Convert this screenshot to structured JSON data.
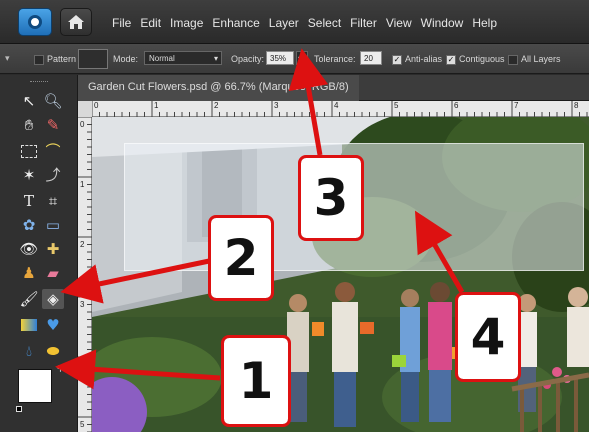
{
  "menu": {
    "items": [
      "File",
      "Edit",
      "Image",
      "Enhance",
      "Layer",
      "Select",
      "Filter",
      "View",
      "Window",
      "Help"
    ]
  },
  "options": {
    "pattern_label": "Pattern",
    "mode_label": "Mode:",
    "mode_value": "Normal",
    "opacity_label": "Opacity:",
    "opacity_value": "35%",
    "tolerance_label": "Tolerance:",
    "tolerance_value": "20",
    "antialias_label": "Anti-alias",
    "antialias_checked": true,
    "contiguous_label": "Contiguous",
    "contiguous_checked": true,
    "all_layers_label": "All Layers",
    "all_layers_checked": false
  },
  "document": {
    "tab_title": "Garden Cut Flowers.psd @ 66.7% (Marquee, RGB/8)"
  },
  "rulers": {
    "top": [
      "0",
      "1",
      "2",
      "3",
      "4",
      "5",
      "6",
      "7",
      "8"
    ],
    "left": [
      "0",
      "1",
      "2",
      "3",
      "4",
      "5"
    ]
  },
  "callouts": [
    "1",
    "2",
    "3",
    "4"
  ],
  "colors": {
    "callout_border": "#dd1111",
    "arrow": "#dd1111",
    "app_logo": "#2b86d6"
  }
}
